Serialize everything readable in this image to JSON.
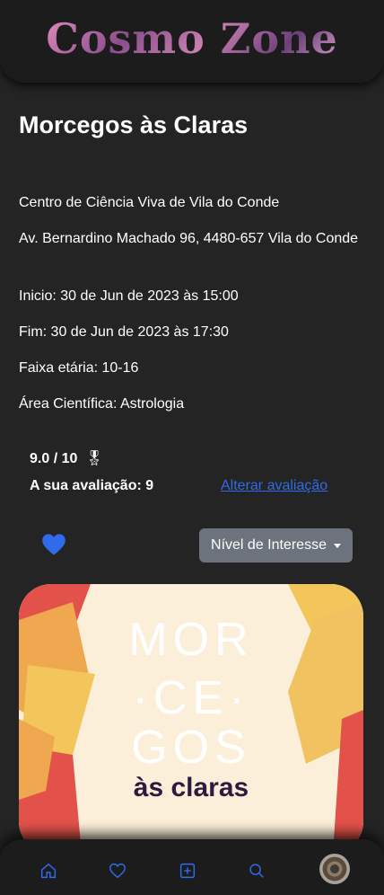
{
  "header": {
    "logo_text": "Cosmo Zone"
  },
  "event": {
    "title": "Morcegos às Claras",
    "venue": "Centro de Ciência Viva de Vila do Conde",
    "address": "Av. Bernardino Machado 96, 4480-657 Vila do Conde",
    "start": "Inicio: 30 de Jun de 2023 às 15:00",
    "end": "Fim: 30 de Jun de 2023 às 17:30",
    "age_range": "Faixa etária: 10-16",
    "science_area": "Área Científica: Astrologia"
  },
  "rating": {
    "score": "9.0 / 10",
    "medal_glyph": "🎖",
    "user_rating": "A sua avaliação: 9",
    "change_link": "Alterar avaliação"
  },
  "actions": {
    "favorited": true,
    "interest_button": "Nível de Interesse"
  },
  "poster": {
    "line1": "MOR",
    "line2": "·CE·",
    "line3": "GOS",
    "line4": "às claras"
  },
  "bottom_nav": {
    "items": [
      "home-icon",
      "heart-icon",
      "plus-square-icon",
      "search-icon",
      "avatar"
    ],
    "accent_color": "#2f6bea"
  },
  "colors": {
    "background": "#242424",
    "bar": "#1c1c1c",
    "link": "#2f6bea",
    "button": "#6c737d"
  }
}
